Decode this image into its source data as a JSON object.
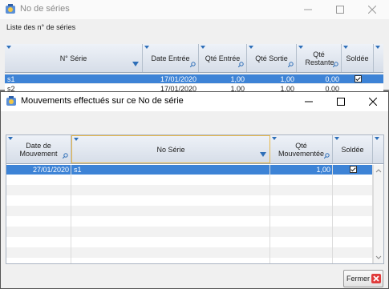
{
  "back_window": {
    "title": "No de séries",
    "subtitle": "Liste des n° de séries",
    "columns": [
      "N° Série",
      "Date Entrée",
      "Qté Entrée",
      "Qté Sortie",
      "Qté Restante",
      "Soldée"
    ],
    "row1": {
      "serie": "s1",
      "date": "17/01/2020",
      "qte_entree": "1,00",
      "qte_sortie": "1,00",
      "restante": "0,00",
      "soldee": true
    },
    "row2": {
      "serie": "s2",
      "date": "17/01/2020",
      "qte_entree": "1,00",
      "qte_sortie": "1,00",
      "restante": "0,00"
    }
  },
  "front_window": {
    "title": "Mouvements effectués sur ce No de série",
    "columns": [
      "Date de Mouvement",
      "No Série",
      "Qté Mouvementée",
      "Soldée"
    ],
    "rows": [
      {
        "date": "27/01/2020",
        "serie": "s1",
        "qte": "1,00",
        "soldee": true
      }
    ],
    "close_button": "Fermer"
  },
  "colors": {
    "selection": "#3d83d6",
    "header_gradient_top": "#eef2f8",
    "sort_accent": "#2e6fb8"
  },
  "icons": [
    "app-icon",
    "minimize-icon",
    "maximize-icon",
    "close-icon",
    "sort-icon",
    "search-icon",
    "filter-icon",
    "checkbox-icon",
    "fermer-close-icon"
  ]
}
